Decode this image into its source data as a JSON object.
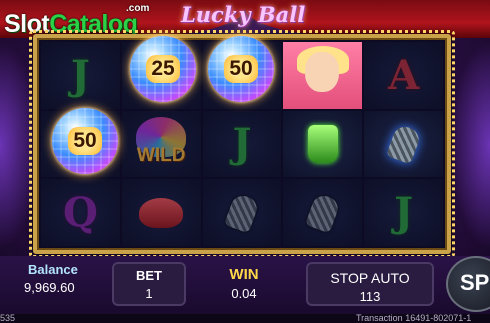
{
  "watermark": {
    "part1": "Slot",
    "part2": "Catalog",
    "suffix": ".com"
  },
  "game_title": "Lucky Ball",
  "reels": {
    "balls": [
      {
        "value": "25"
      },
      {
        "value": "50"
      },
      {
        "value": "50"
      }
    ],
    "symbols": {
      "r0c0": "J",
      "r2c0": "Q",
      "r1c1": "WILD",
      "r1c2": "J",
      "r0c4": "A",
      "r2c4": "J"
    }
  },
  "panel": {
    "balance_label": "Balance",
    "balance_value": "9,969.60",
    "bet_label": "BET",
    "bet_value": "1",
    "win_label": "WIN",
    "win_value": "0.04",
    "stop_auto_label": "STOP AUTO",
    "stop_auto_value": "113",
    "spin_label": "SP"
  },
  "footer": {
    "left": "535",
    "transaction": "Transaction  16491-802071-1"
  },
  "colors": {
    "accent_gold": "#ffd84a",
    "balance_label": "#b3e4ff",
    "wild": "#ffbf3a"
  }
}
